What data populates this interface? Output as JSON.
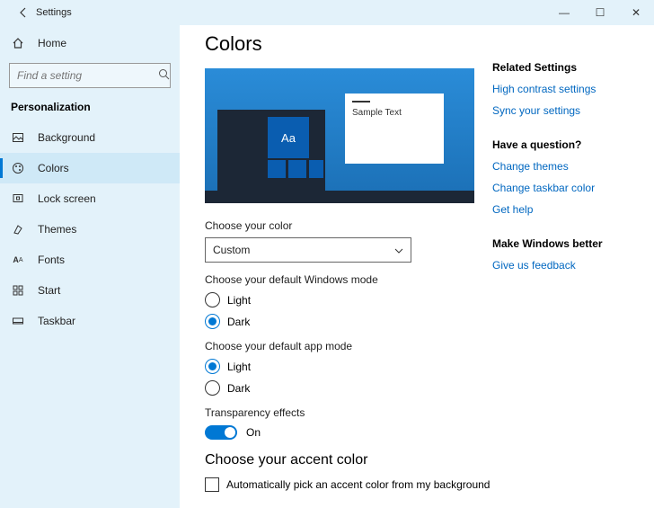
{
  "window": {
    "title": "Settings",
    "back_icon": "←"
  },
  "window_controls": {
    "min": "—",
    "max": "☐",
    "close": "✕"
  },
  "sidebar": {
    "home_label": "Home",
    "search_placeholder": "Find a setting",
    "section": "Personalization",
    "items": [
      {
        "icon": "bg",
        "label": "Background"
      },
      {
        "icon": "colors",
        "label": "Colors"
      },
      {
        "icon": "lock",
        "label": "Lock screen"
      },
      {
        "icon": "themes",
        "label": "Themes"
      },
      {
        "icon": "fonts",
        "label": "Fonts"
      },
      {
        "icon": "start",
        "label": "Start"
      },
      {
        "icon": "taskbar",
        "label": "Taskbar"
      }
    ],
    "active_index": 1
  },
  "page": {
    "title": "Colors",
    "preview": {
      "sample_text": "Sample Text",
      "aa": "Aa"
    },
    "choose_color_label": "Choose your color",
    "choose_color_value": "Custom",
    "windows_mode_label": "Choose your default Windows mode",
    "windows_mode": {
      "light": "Light",
      "dark": "Dark",
      "selected": "dark"
    },
    "app_mode_label": "Choose your default app mode",
    "app_mode": {
      "light": "Light",
      "dark": "Dark",
      "selected": "light"
    },
    "transparency_label": "Transparency effects",
    "transparency_state": "On",
    "accent_heading": "Choose your accent color",
    "auto_accent_label": "Automatically pick an accent color from my background"
  },
  "right": {
    "related_heading": "Related Settings",
    "related_links": [
      "High contrast settings",
      "Sync your settings"
    ],
    "question_heading": "Have a question?",
    "question_links": [
      "Change themes",
      "Change taskbar color",
      "Get help"
    ],
    "feedback_heading": "Make Windows better",
    "feedback_links": [
      "Give us feedback"
    ]
  }
}
